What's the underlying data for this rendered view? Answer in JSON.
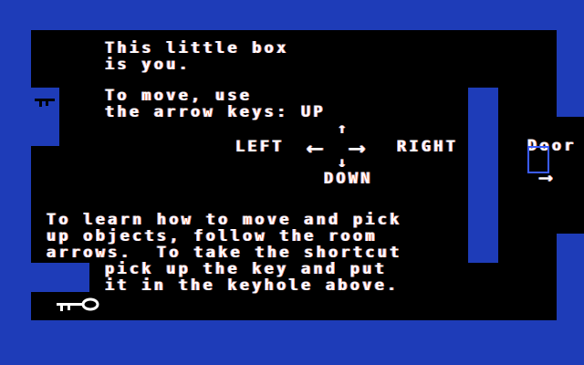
{
  "colors": {
    "wall": "#1e3cb8",
    "floor": "#000000",
    "text": "#ffffff",
    "player": "#3a5bff"
  },
  "intro": {
    "line1": "This little box",
    "line2": "is you."
  },
  "move": {
    "line1": "To move, use",
    "line2": "the arrow keys: UP",
    "left": "LEFT",
    "right": "RIGHT",
    "down": "DOWN",
    "arrow_up": "↑",
    "arrow_down": "↓",
    "arrow_left": "⟵",
    "arrow_right": "⟶"
  },
  "instructions": {
    "line1": "To learn how to move and pick",
    "line2": "up objects, follow the room",
    "line3": "arrows.  To take the shortcut",
    "line4": "pick up the key and put",
    "line5": "it in the keyhole above."
  },
  "door": {
    "label": "Door",
    "arrow": "⟶"
  },
  "icons": {
    "key": "key-icon",
    "keyhole": "keyhole-icon",
    "player": "player-box"
  }
}
